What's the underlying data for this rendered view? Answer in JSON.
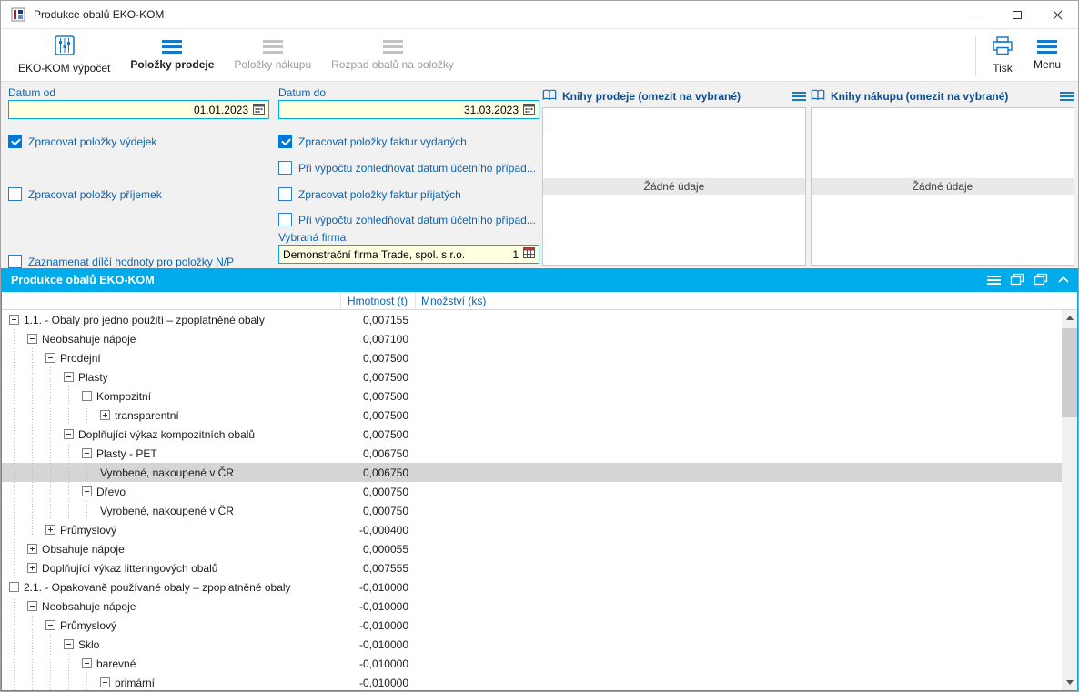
{
  "window": {
    "title": "Produkce obalů EKO-KOM"
  },
  "toolbar": {
    "buttons": [
      {
        "label": "EKO-KOM výpočet",
        "icon": "abacus-icon",
        "enabled": true,
        "active": false
      },
      {
        "label": "Položky prodeje",
        "icon": "list-icon",
        "enabled": true,
        "active": true
      },
      {
        "label": "Položky nákupu",
        "icon": "list-icon",
        "enabled": false,
        "active": false
      },
      {
        "label": "Rozpad obalů na položky",
        "icon": "list-icon",
        "enabled": false,
        "active": false
      }
    ],
    "print_label": "Tisk",
    "menu_label": "Menu"
  },
  "filters": {
    "date_from_label": "Datum od",
    "date_from_value": "01.01.2023",
    "date_to_label": "Datum do",
    "date_to_value": "31.03.2023",
    "col1_checkboxes": [
      {
        "label": "Zpracovat položky výdejek",
        "checked": true
      },
      {
        "label": "Zpracovat položky příjemek",
        "checked": false
      },
      {
        "label": "Zaznamenat dílčí hodnoty pro položky N/P",
        "checked": false
      }
    ],
    "col2_checkboxes": [
      {
        "label": "Zpracovat položky faktur vydaných",
        "checked": true
      },
      {
        "label": "Při výpočtu zohledňovat datum účetního případ...",
        "checked": false
      },
      {
        "label": "Zpracovat položky faktur přijatých",
        "checked": false
      },
      {
        "label": "Při výpočtu zohledňovat datum účetního případ...",
        "checked": false
      }
    ],
    "company_label": "Vybraná firma",
    "company_value": "Demonstrační firma Trade, spol. s r.o.",
    "company_number": "1"
  },
  "sales_books_panel": {
    "title": "Knihy prodeje (omezit na vybrané)",
    "empty_text": "Žádné údaje"
  },
  "purchase_books_panel": {
    "title": "Knihy nákupu (omezit na vybrané)",
    "empty_text": "Žádné údaje"
  },
  "result_panel": {
    "title": "Produkce obalů EKO-KOM",
    "columns": {
      "weight": "Hmotnost (t)",
      "quantity": "Množství (ks)"
    },
    "tree_rows": [
      {
        "level": 0,
        "toggle": "minus",
        "label": "1.1. - Obaly pro jedno použití – zpoplatněné obaly",
        "weight": "0,007155",
        "quantity": "",
        "selected": false
      },
      {
        "level": 1,
        "toggle": "minus",
        "label": "Neobsahuje nápoje",
        "weight": "0,007100",
        "quantity": "",
        "selected": false
      },
      {
        "level": 2,
        "toggle": "minus",
        "label": "Prodejní",
        "weight": "0,007500",
        "quantity": "",
        "selected": false
      },
      {
        "level": 3,
        "toggle": "minus",
        "label": "Plasty",
        "weight": "0,007500",
        "quantity": "",
        "selected": false
      },
      {
        "level": 4,
        "toggle": "minus",
        "label": "Kompozitní",
        "weight": "0,007500",
        "quantity": "",
        "selected": false
      },
      {
        "level": 5,
        "toggle": "plus",
        "label": "transparentní",
        "weight": "0,007500",
        "quantity": "",
        "selected": false
      },
      {
        "level": 3,
        "toggle": "minus",
        "label": "Doplňující výkaz kompozitních obalů",
        "weight": "0,007500",
        "quantity": "",
        "selected": false
      },
      {
        "level": 4,
        "toggle": "minus",
        "label": "Plasty - PET",
        "weight": "0,006750",
        "quantity": "",
        "selected": false
      },
      {
        "level": 5,
        "toggle": "none",
        "label": "Vyrobené, nakoupené v ČR",
        "weight": "0,006750",
        "quantity": "",
        "selected": true
      },
      {
        "level": 4,
        "toggle": "minus",
        "label": "Dřevo",
        "weight": "0,000750",
        "quantity": "",
        "selected": false
      },
      {
        "level": 5,
        "toggle": "none",
        "label": "Vyrobené, nakoupené v ČR",
        "weight": "0,000750",
        "quantity": "",
        "selected": false
      },
      {
        "level": 2,
        "toggle": "plus",
        "label": "Průmyslový",
        "weight": "-0,000400",
        "quantity": "",
        "selected": false
      },
      {
        "level": 1,
        "toggle": "plus",
        "label": "Obsahuje nápoje",
        "weight": "0,000055",
        "quantity": "",
        "selected": false
      },
      {
        "level": 1,
        "toggle": "plus",
        "label": "Doplňující výkaz litteringových obalů",
        "weight": "0,007555",
        "quantity": "",
        "selected": false
      },
      {
        "level": 0,
        "toggle": "minus",
        "label": "2.1. - Opakovaně používané obaly – zpoplatněné obaly",
        "weight": "-0,010000",
        "quantity": "",
        "selected": false
      },
      {
        "level": 1,
        "toggle": "minus",
        "label": "Neobsahuje nápoje",
        "weight": "-0,010000",
        "quantity": "",
        "selected": false
      },
      {
        "level": 2,
        "toggle": "minus",
        "label": "Průmyslový",
        "weight": "-0,010000",
        "quantity": "",
        "selected": false
      },
      {
        "level": 3,
        "toggle": "minus",
        "label": "Sklo",
        "weight": "-0,010000",
        "quantity": "",
        "selected": false
      },
      {
        "level": 4,
        "toggle": "minus",
        "label": "barevné",
        "weight": "-0,010000",
        "quantity": "",
        "selected": false
      },
      {
        "level": 5,
        "toggle": "minus",
        "label": "primární",
        "weight": "-0,010000",
        "quantity": "",
        "selected": false
      }
    ]
  },
  "colors": {
    "accent_cyan": "#00abeb",
    "input_yellow": "#ffffe1",
    "label_blue": "#0f62ac",
    "icon_blue": "#1878c8",
    "selected_row": "#d5d5d5",
    "checked_blue": "#0078d7"
  }
}
